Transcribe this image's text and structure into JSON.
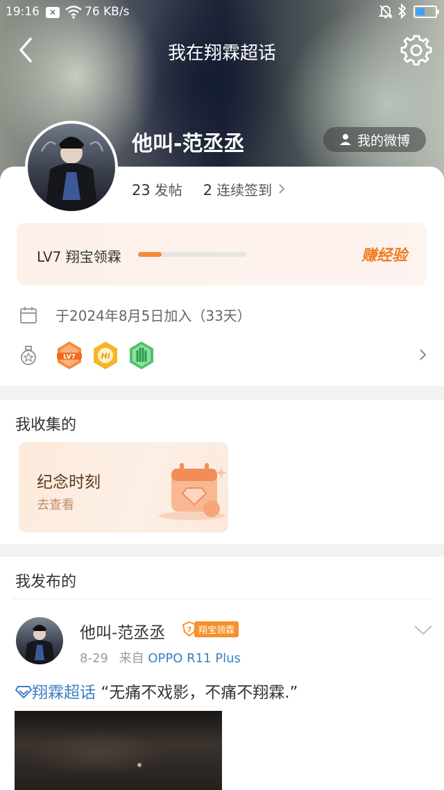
{
  "status_bar": {
    "time": "19:16",
    "network_speed": "76 KB/s",
    "battery_level": 0.45
  },
  "nav": {
    "title": "我在翔霖超话"
  },
  "profile": {
    "username": "他叫-范丞丞",
    "my_weibo_label": "我的微博",
    "posts_count": "23",
    "posts_label": "发帖",
    "checkin_count": "2",
    "checkin_label": "连续签到"
  },
  "level": {
    "label": "LV7 翔宝领霖",
    "progress": 0.22,
    "earn_label": "赚经验"
  },
  "join_text": "于2024年8月5日加入（33天）",
  "badges": [
    {
      "name": "LV7",
      "color": "#f58a3c"
    },
    {
      "name": "Hi",
      "color": "#f5b52a"
    },
    {
      "name": "hand",
      "color": "#4cc26a"
    }
  ],
  "collection": {
    "title": "我收集的",
    "card_title": "纪念时刻",
    "card_sub": "去查看"
  },
  "posts_section": {
    "title": "我发布的",
    "post": {
      "user": "他叫-范丞丞",
      "level_num": "7",
      "level_tag": "翔宝领霖",
      "date": "8-29",
      "from_prefix": "来自",
      "device": "OPPO R11 Plus",
      "topic": "翔霖超话",
      "text": "“无痛不戏影，不痛不翔霖.”"
    }
  },
  "colors": {
    "accent_orange": "#f58a3c",
    "link_blue": "#3b7fc4"
  }
}
